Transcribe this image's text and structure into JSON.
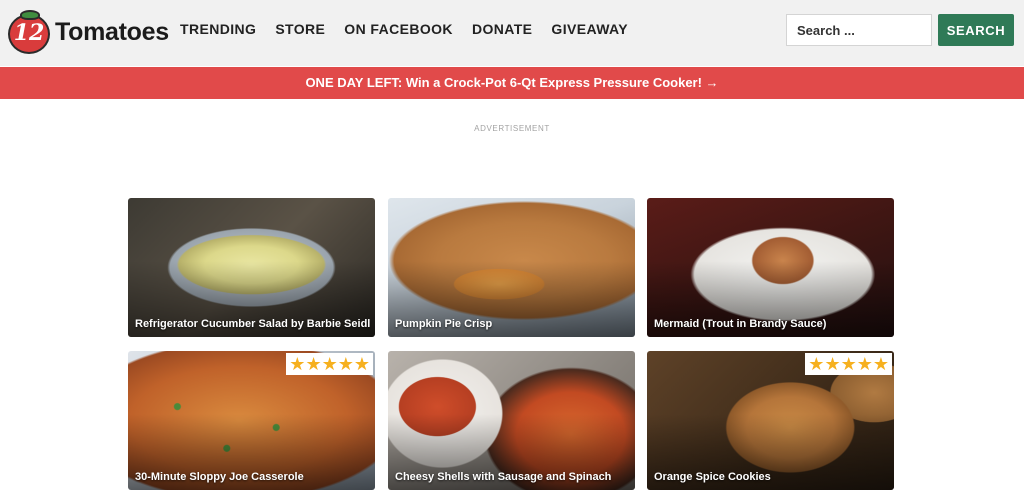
{
  "logo": {
    "number": "12",
    "name": "Tomatoes"
  },
  "nav": [
    {
      "label": "TRENDING"
    },
    {
      "label": "STORE"
    },
    {
      "label": "ON FACEBOOK"
    },
    {
      "label": "DONATE"
    },
    {
      "label": "GIVEAWAY"
    }
  ],
  "search": {
    "placeholder": "Search ...",
    "button_label": "SEARCH"
  },
  "promo": {
    "text": "ONE DAY LEFT: Win a Crock-Pot 6-Qt Express Pressure Cooker! →"
  },
  "ad_label": "ADVERTISEMENT",
  "recipes": [
    {
      "title": "Refrigerator Cucumber Salad by Barbie Seidl",
      "rating": null
    },
    {
      "title": "Pumpkin Pie Crisp",
      "rating": null
    },
    {
      "title": "Mermaid (Trout in Brandy Sauce)",
      "rating": null
    },
    {
      "title": "30-Minute Sloppy Joe Casserole",
      "rating": 5
    },
    {
      "title": "Cheesy Shells with Sausage and Spinach",
      "rating": null
    },
    {
      "title": "Orange Spice Cookies",
      "rating": 5
    }
  ],
  "colors": {
    "promo_bar": "#e14a4a",
    "search_button": "#2f7a57",
    "star": "#f6b01e",
    "header_bg": "#f1f1f1"
  },
  "icons": {
    "rating_star": "star-icon",
    "logo": "tomato-logo-icon"
  }
}
